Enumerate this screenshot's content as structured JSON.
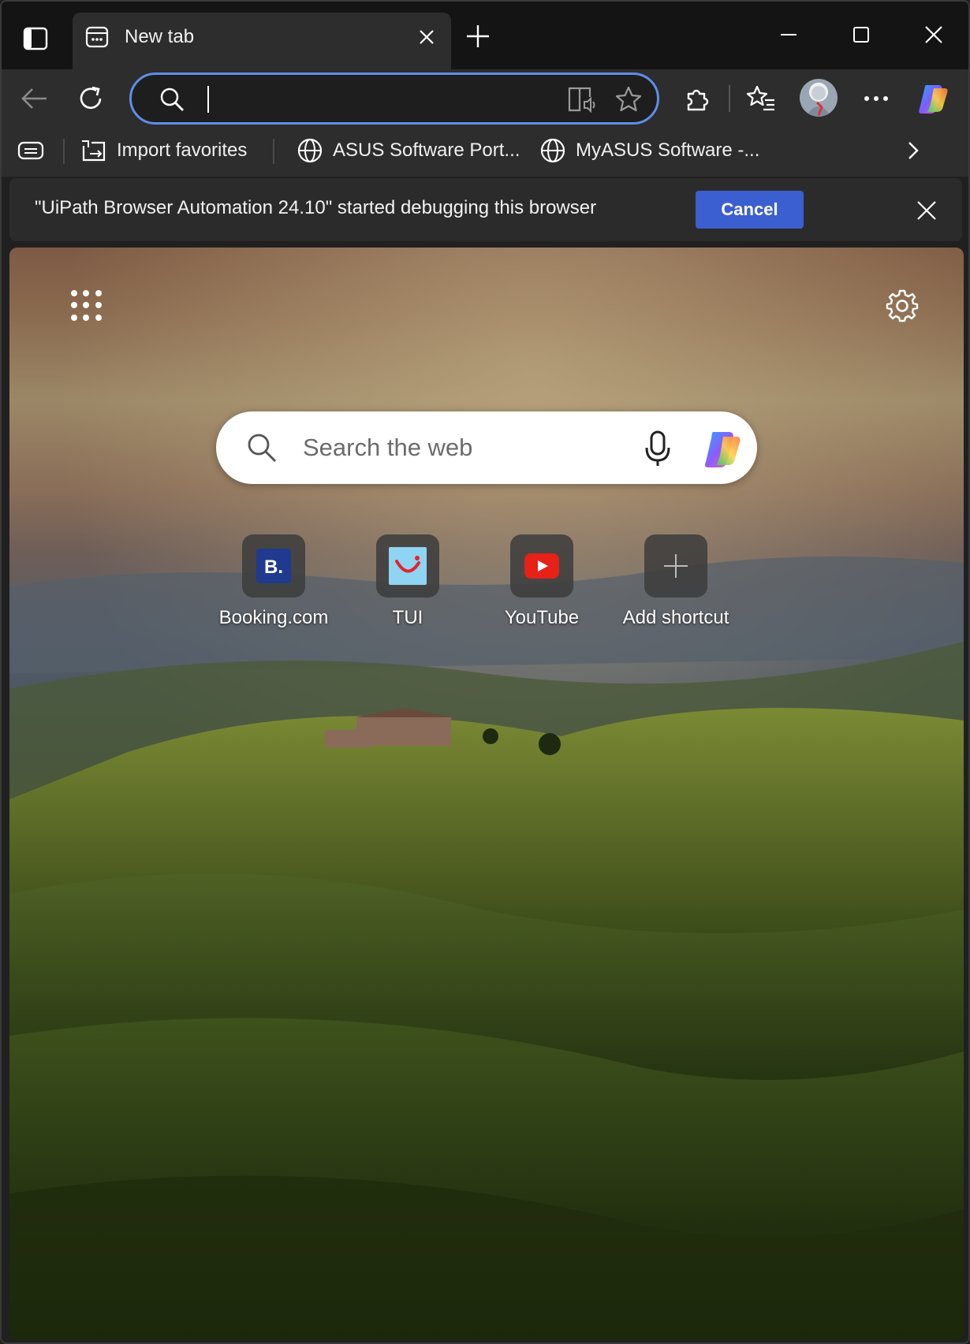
{
  "tab": {
    "title": "New tab"
  },
  "omnibox": {
    "value": ""
  },
  "favorites_bar": {
    "items": [
      {
        "label": "Import favorites",
        "icon": "import-icon"
      },
      {
        "label": "ASUS Software Port...",
        "icon": "globe-icon"
      },
      {
        "label": "MyASUS Software -...",
        "icon": "globe-icon"
      }
    ]
  },
  "infobar": {
    "message": "\"UiPath Browser Automation 24.10\" started debugging this browser",
    "cancel_label": "Cancel"
  },
  "ntp": {
    "search_placeholder": "Search the web",
    "shortcuts": [
      {
        "label": "Booking.com",
        "icon": "booking-icon"
      },
      {
        "label": "TUI",
        "icon": "tui-icon"
      },
      {
        "label": "YouTube",
        "icon": "youtube-icon"
      },
      {
        "label": "Add shortcut",
        "icon": "plus-icon"
      }
    ]
  },
  "colors": {
    "accent": "#3b5fd0",
    "omnibox_focus": "#5e8ee8",
    "toolbar_bg": "#2d2d2d",
    "tabstrip_bg": "#141414"
  }
}
